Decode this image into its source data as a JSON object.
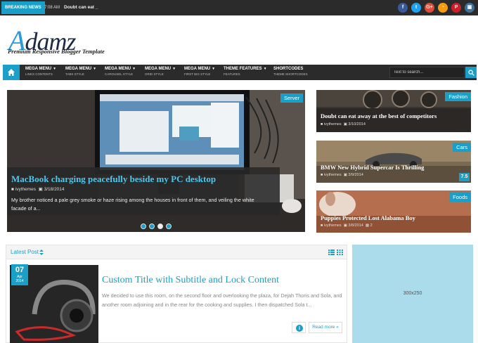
{
  "topbar": {
    "breaking_label": "BREAKING NEWS",
    "time": "7:08 AM",
    "ticker_text": "Doubt can eat",
    "social": [
      {
        "icon": "facebook-icon",
        "glyph": "f",
        "color": "#3b5998"
      },
      {
        "icon": "twitter-icon",
        "glyph": "t",
        "color": "#1da1f2"
      },
      {
        "icon": "google-plus-icon",
        "glyph": "G+",
        "color": "#dd4b39"
      },
      {
        "icon": "rss-icon",
        "glyph": "◔",
        "color": "#f39c12"
      },
      {
        "icon": "pinterest-icon",
        "glyph": "P",
        "color": "#cb2027"
      },
      {
        "icon": "instagram-icon",
        "glyph": "▣",
        "color": "#3f729b"
      }
    ]
  },
  "header": {
    "logo_initial": "A",
    "logo_rest": "damz",
    "tagline": "Premium Responsive Blogger Template"
  },
  "nav": {
    "items": [
      {
        "title": "MEGA MENU",
        "sub": "LINKS CONTENTS"
      },
      {
        "title": "MEGA MENU",
        "sub": "TABS STYLE"
      },
      {
        "title": "MEGA MENU",
        "sub": "CAROUSEL STYLE"
      },
      {
        "title": "MEGA MENU",
        "sub": "GRID STYLE"
      },
      {
        "title": "MEGA MENU",
        "sub": "FIRST BIG STYLE"
      },
      {
        "title": "THEME FEATURES",
        "sub": "FEATURES"
      },
      {
        "title": "SHORTCODES",
        "sub": "THEME SHORTCODES"
      }
    ],
    "search_placeholder": "Text to search..."
  },
  "slider": {
    "tag": "Server",
    "title": "MacBook charging peacefully beside my PC desktop",
    "author": "ivythemes",
    "date": "3/18/2014",
    "excerpt": "My brother noticed a pale grey smoke or haze rising among the houses in front of them, and veiling the white facade of a...",
    "dots": 4,
    "active_dot": 2
  },
  "cards": [
    {
      "tag": "Fashion",
      "title": "Doubt can eat away at the best of competitors",
      "author": "ivythemes",
      "date": "3/10/2014",
      "comments": "",
      "rating": ""
    },
    {
      "tag": "Cars",
      "title": "BMW New Hybrid Supercar Is Thrilling",
      "author": "ivythemes",
      "date": "3/9/2014",
      "comments": "",
      "rating": "7.5"
    },
    {
      "tag": "Foods",
      "title": "Puppies Protected Lost Alabama Boy",
      "author": "ivythemes",
      "date": "3/8/2014",
      "comments": "2",
      "rating": ""
    }
  ],
  "latest": {
    "label": "Latest Post",
    "post": {
      "day": "07",
      "month": "Apr",
      "year": "2014",
      "title": "Custom Title with Subtitle and Lock Content",
      "excerpt": "We decided to use this room, on the second floor and overlooking the plaza, for Dejah Thoris and Sola, and another room adjoining and in the rear for the cooking and supplies. I then dispatched Sola t...",
      "more_label": "Read more »",
      "info_glyph": "i"
    }
  },
  "ad": {
    "label": "300x250"
  },
  "colors": {
    "accent": "#1aa0c8",
    "dark": "#2b2b2b"
  }
}
